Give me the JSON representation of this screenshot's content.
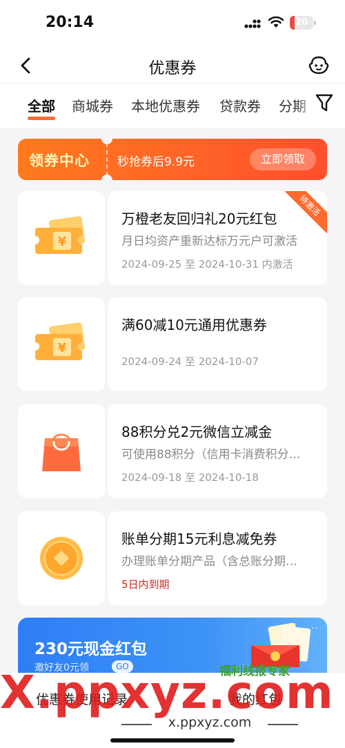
{
  "status_bar": {
    "time": "20:14",
    "battery": "20",
    "battery_level": 0.2
  },
  "nav": {
    "title": "优惠券"
  },
  "tabs": [
    {
      "label": "全部",
      "active": true
    },
    {
      "label": "商城券",
      "active": false
    },
    {
      "label": "本地优惠券",
      "active": false
    },
    {
      "label": "贷款券",
      "active": false
    },
    {
      "label": "分期",
      "active": false
    }
  ],
  "banner": {
    "title": "领券中心",
    "subtitle": "秒抢券后9.9元",
    "button": "立即领取"
  },
  "coupons": [
    {
      "icon": "ticket-icon",
      "title": "万橙老友回归礼20元红包",
      "desc": "月日均资产重新达标万元户可激活",
      "date": "2024-09-25 至 2024-10-31 内激活",
      "badge": "待激活"
    },
    {
      "icon": "ticket-icon",
      "title": "满60减10元通用优惠券",
      "date": "2024-09-24 至 2024-10-07"
    },
    {
      "icon": "shopping-bag-icon",
      "title": "88积分兑2元微信立减金",
      "desc": "可使用88积分（信用卡消费积分…",
      "date": "2024-09-18 至 2024-10-18"
    },
    {
      "icon": "coin-icon",
      "title": "账单分期15元利息减免券",
      "desc": "办理账单分期产品（含总账分期…",
      "date": "5日内到期"
    }
  ],
  "promo": {
    "title": "230元现金红包",
    "subtitle": "邀好友0元领",
    "go": "GO",
    "more": "··"
  },
  "bottom": {
    "left_link": "优惠券使用记录",
    "right_link": "我的红包"
  },
  "watermark": {
    "main": "X.ppxyz.com",
    "sub": "x.ppxyz.com",
    "stamp": "福利线报专家"
  },
  "colors": {
    "accent": "#ff6a2e",
    "warning": "#d0281f",
    "promo_blue": "#2e7ef5"
  }
}
